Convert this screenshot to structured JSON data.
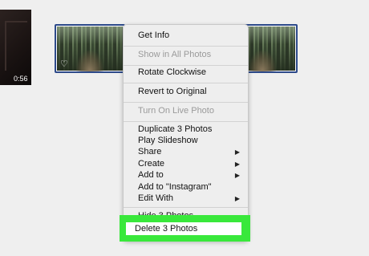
{
  "video": {
    "duration": "0:56"
  },
  "menu": {
    "items": [
      {
        "label": "Get Info",
        "disabled": false
      },
      {
        "label": "Show in All Photos",
        "disabled": true
      },
      {
        "label": "Rotate Clockwise",
        "disabled": false
      },
      {
        "label": "Revert to Original",
        "disabled": false
      },
      {
        "label": "Turn On Live Photo",
        "disabled": true
      },
      {
        "label": "Duplicate 3 Photos",
        "disabled": false
      },
      {
        "label": "Play Slideshow",
        "disabled": false
      },
      {
        "label": "Share",
        "disabled": false,
        "submenu": true
      },
      {
        "label": "Create",
        "disabled": false,
        "submenu": true
      },
      {
        "label": "Add to",
        "disabled": false,
        "submenu": true
      },
      {
        "label": "Add to \"Instagram\"",
        "disabled": false
      },
      {
        "label": "Edit With",
        "disabled": false,
        "submenu": true
      },
      {
        "label": "Hide 3 Photos",
        "disabled": false
      },
      {
        "label": "Delete 3 Photos",
        "disabled": false,
        "highlighted": true
      }
    ],
    "submenu_arrow": "▶"
  },
  "colors": {
    "highlight": "#39e83b",
    "selection_border": "#2d4a8a"
  }
}
